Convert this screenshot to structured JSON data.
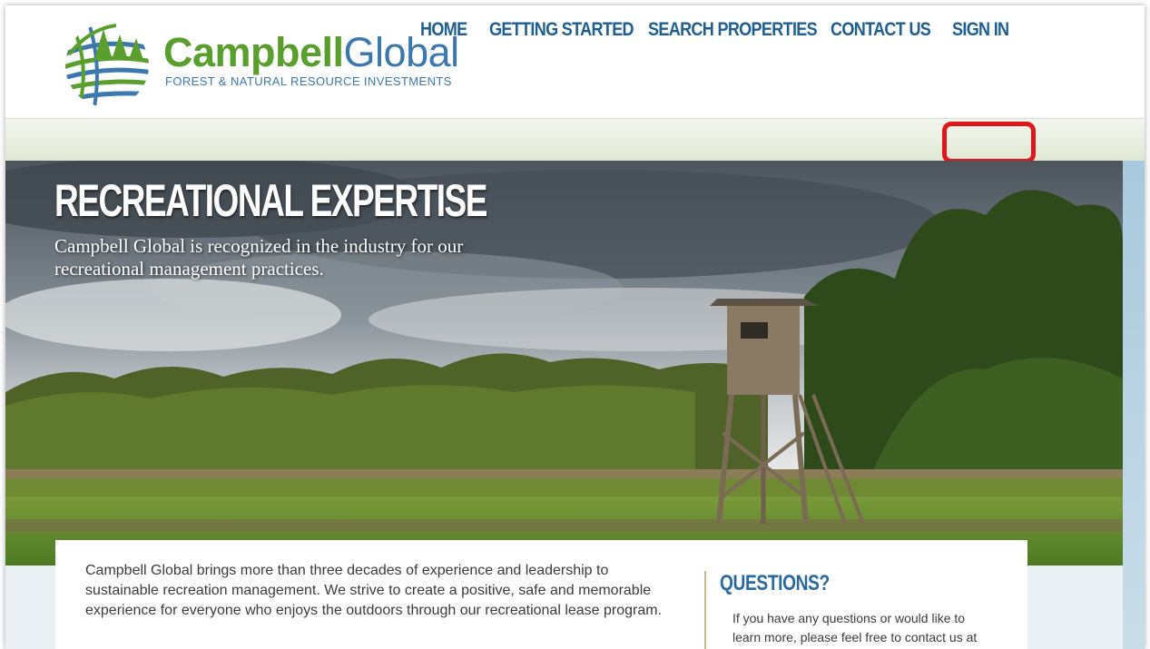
{
  "brand": {
    "name_strong": "Campbell",
    "name_light": "Global",
    "tagline": "FOREST & NATURAL RESOURCE INVESTMENTS",
    "colors": {
      "green": "#5a9f2e",
      "blue": "#3b78ad"
    }
  },
  "nav": {
    "items": [
      {
        "label": "HOME"
      },
      {
        "label": "GETTING STARTED"
      },
      {
        "label": "SEARCH PROPERTIES"
      },
      {
        "label": "CONTACT US"
      },
      {
        "label": "SIGN IN"
      }
    ],
    "highlighted": "SIGN IN",
    "highlight_color": "#e0161b"
  },
  "hero": {
    "title": "RECREATIONAL EXPERTISE",
    "subtitle": "Campbell Global is recognized in the industry for our recreational management practices."
  },
  "main": {
    "intro": "Campbell Global brings more than three decades of experience and leadership to sustainable recreation management. We strive to create a positive, safe and memorable experience for everyone who enjoys the outdoors through our recreational lease program."
  },
  "sidebar": {
    "title": "QUESTIONS?",
    "text": "If you have any questions or would like to learn more, please feel free to contact us at"
  }
}
